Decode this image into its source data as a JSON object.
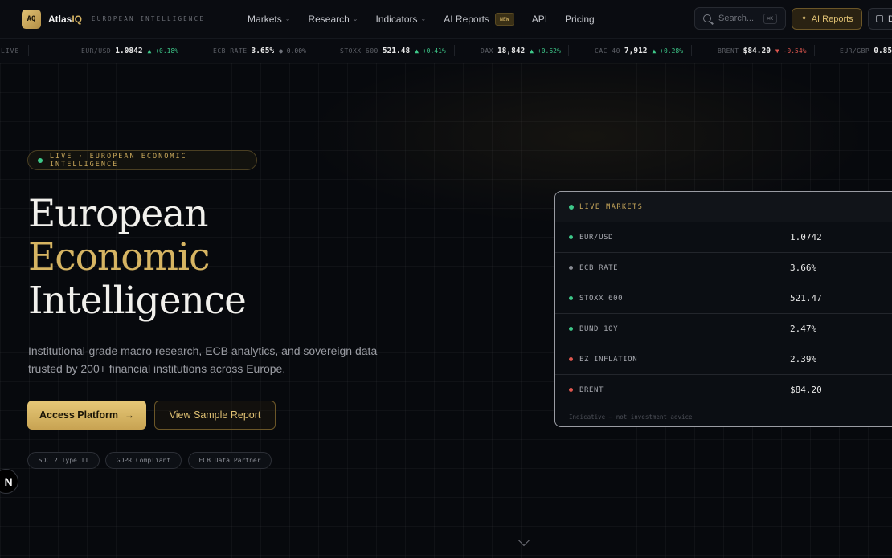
{
  "nav": {
    "logo": "AQ",
    "brand_main": "Atlas",
    "brand_accent": "IQ",
    "tagline": "EUROPEAN INTELLIGENCE",
    "links": [
      {
        "label": "Markets",
        "dropdown": true
      },
      {
        "label": "Research",
        "dropdown": true
      },
      {
        "label": "Indicators",
        "dropdown": true
      },
      {
        "label": "AI Reports",
        "badge": "NEW"
      },
      {
        "label": "API"
      },
      {
        "label": "Pricing"
      }
    ],
    "search_placeholder": "Search...",
    "search_shortcut": "⌘K",
    "ai_button": "AI Reports",
    "edge_button_letter": "D"
  },
  "ticker": {
    "live_label": "LIVE",
    "items": [
      {
        "label": "EUR/USD",
        "value": "1.0842",
        "change": "▲ +0.18%",
        "dir": "up"
      },
      {
        "label": "ECB RATE",
        "value": "3.65%",
        "change": "● 0.00%",
        "dir": "flat"
      },
      {
        "label": "STOXX 600",
        "value": "521.48",
        "change": "▲ +0.41%",
        "dir": "up"
      },
      {
        "label": "DAX",
        "value": "18,842",
        "change": "▲ +0.62%",
        "dir": "up"
      },
      {
        "label": "CAC 40",
        "value": "7,912",
        "change": "▲ +0.28%",
        "dir": "up"
      },
      {
        "label": "BRENT",
        "value": "$84.20",
        "change": "▼ -0.54%",
        "dir": "down"
      },
      {
        "label": "EUR/GBP",
        "value": "0.85",
        "change": "",
        "dir": "flat"
      }
    ]
  },
  "hero": {
    "pill": "LIVE · EUROPEAN ECONOMIC INTELLIGENCE",
    "title_line1": "European",
    "title_line2": "Economic",
    "title_line3": "Intelligence",
    "subtitle": "Institutional-grade macro research, ECB analytics, and sovereign data — trusted by 200+ financial institutions across Europe.",
    "primary_cta": "Access Platform",
    "secondary_cta": "View Sample Report",
    "certs": [
      "SOC 2 Type II",
      "GDPR Compliant",
      "ECB Data Partner"
    ],
    "n_badge": "N"
  },
  "markets": {
    "title": "LIVE MARKETS",
    "rows": [
      {
        "name": "EUR/USD",
        "value": "1.0742",
        "status": "green"
      },
      {
        "name": "ECB RATE",
        "value": "3.66%",
        "status": "grey"
      },
      {
        "name": "STOXX 600",
        "value": "521.47",
        "status": "green"
      },
      {
        "name": "BUND 10Y",
        "value": "2.47%",
        "status": "green"
      },
      {
        "name": "EZ INFLATION",
        "value": "2.39%",
        "status": "red"
      },
      {
        "name": "BRENT",
        "value": "$84.20",
        "status": "red"
      }
    ],
    "footer": "Indicative — not investment advice"
  },
  "colors": {
    "accent_gold": "#d6b462",
    "up": "#3ec98a",
    "down": "#e0574f",
    "background": "#07090d"
  }
}
